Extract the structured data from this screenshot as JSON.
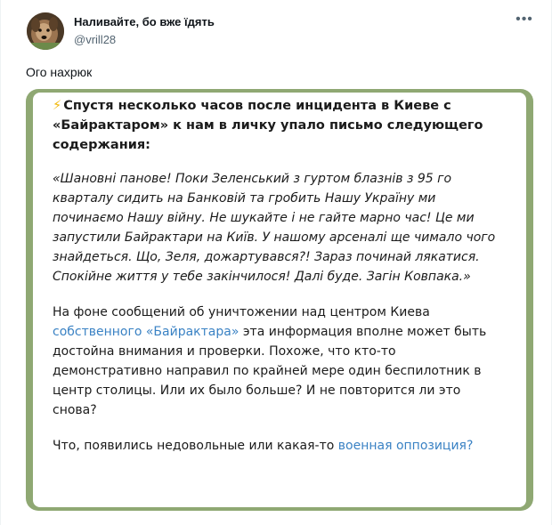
{
  "author": {
    "name": "Наливайте, бо вже їдять",
    "handle": "@vrill28"
  },
  "menu_icon": "more-horizontal-icon",
  "tweet_text": "Ого нахрюк",
  "colors": {
    "card_border": "#8fa873",
    "link": "#3a82c4",
    "bolt": "#f2b705",
    "handle": "#536471"
  },
  "post": {
    "bolt_icon": "⚡",
    "headline": "Спустя несколько часов после инцидента в Киеве с «Байрактаром» к нам в личку упало письмо следующего содержания:",
    "quote": "«Шановні панове! Поки Зеленський з гуртом блазнів з 95 го кварталу сидить на Банковій та гробить Нашу Україну ми починаємо Нашу війну. Не шукайте і не гайте марно час! Це ми запустили Байрактари на Київ. У нашому арсеналі ще чимало чого знайдеться. Що, Зеля, дожартувався?! Зараз починай лякатися. Спокійне життя у тебе закінчилося! Далі буде. Загін Ковпака.»",
    "para1_before": "На фоне сообщений об уничтожении над центром Киева ",
    "para1_link": "собственного «Байрактара»",
    "para1_after": " эта информация вполне может быть достойна внимания и проверки. Похоже, что кто-то демонстративно направил по крайней мере один беспилотник в центр столицы. Или их было больше? И не повторится ли это снова?",
    "para2_before": "Что, появились недовольные или какая-то ",
    "para2_link": "военная оппозиция?"
  }
}
